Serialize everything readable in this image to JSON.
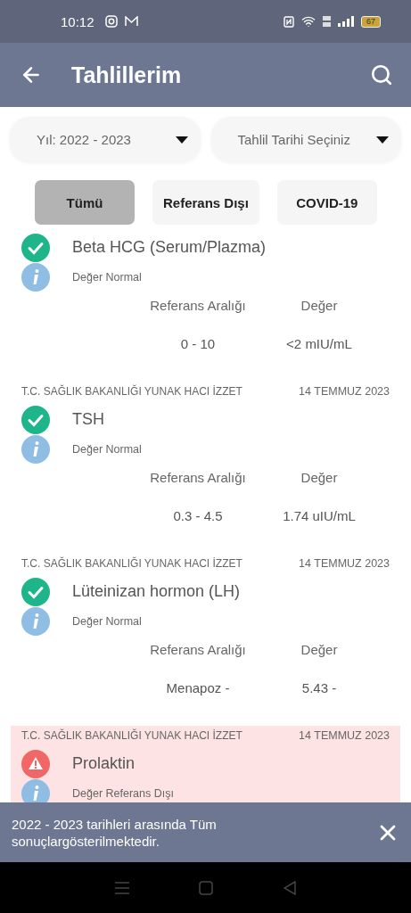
{
  "status_bar": {
    "time": "10:12",
    "battery": "67"
  },
  "app_bar": {
    "title": "Tahlillerim"
  },
  "filters": [
    {
      "value": "Yıl: 2022 - 2023"
    },
    {
      "value": "Tahlil Tarihi Seçiniz"
    }
  ],
  "tabs": [
    {
      "label": "Tümü",
      "selected": true
    },
    {
      "label": "Referans Dışı",
      "selected": false
    },
    {
      "label": "COVID-19",
      "selected": false
    }
  ],
  "results": [
    {
      "kind": "normal",
      "name": "Beta HCG (Serum/Plazma)",
      "status_text": "Değer Normal",
      "range_label": "Referans Aralığı",
      "value_label": "Değer",
      "range": "0 - 10",
      "value": "<2 mIU/mL"
    },
    {
      "hospital": "T.C. SAĞLIK BAKANLIĞI YUNAK HACI İZZET",
      "date": "14 TEMMUZ 2023",
      "kind": "normal",
      "name": "TSH",
      "status_text": "Değer Normal",
      "range_label": "Referans Aralığı",
      "value_label": "Değer",
      "range": "0.3 - 4.5",
      "value": "1.74 uIU/mL"
    },
    {
      "hospital": "T.C. SAĞLIK BAKANLIĞI YUNAK HACI İZZET",
      "date": "14 TEMMUZ 2023",
      "kind": "normal",
      "name": "Lüteinizan hormon (LH)",
      "status_text": "Değer Normal",
      "range_label": "Referans Aralığı",
      "value_label": "Değer",
      "range": "Menapoz -",
      "value": "5.43 -"
    },
    {
      "hospital": "T.C. SAĞLIK BAKANLIĞI YUNAK HACI İZZET",
      "date": "14 TEMMUZ 2023",
      "kind": "out_of_range",
      "name": "Prolaktin",
      "status_text": "Değer Referans Dışı"
    }
  ],
  "snackbar": {
    "message": "2022 - 2023 tarihleri arasında Tüm sonuçlargösterilmektedir."
  }
}
